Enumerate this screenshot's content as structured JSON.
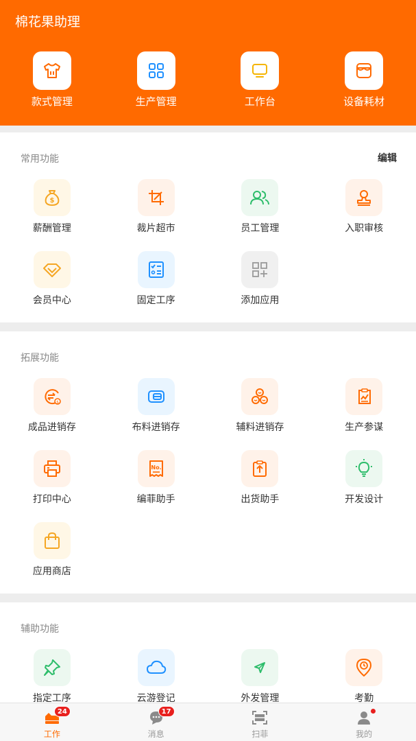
{
  "app": {
    "title": "棉花果助理"
  },
  "quick_actions": [
    {
      "label": "款式管理",
      "icon": "shirt-icon"
    },
    {
      "label": "生产管理",
      "icon": "grid-icon"
    },
    {
      "label": "工作台",
      "icon": "monitor-icon"
    },
    {
      "label": "设备耗材",
      "icon": "store-icon"
    }
  ],
  "sections": {
    "common": {
      "title": "常用功能",
      "edit_label": "编辑",
      "items": [
        {
          "label": "薪酬管理",
          "icon": "money-bag-icon"
        },
        {
          "label": "裁片超市",
          "icon": "crop-icon"
        },
        {
          "label": "员工管理",
          "icon": "users-icon"
        },
        {
          "label": "入职审核",
          "icon": "stamp-icon"
        },
        {
          "label": "会员中心",
          "icon": "diamond-icon"
        },
        {
          "label": "固定工序",
          "icon": "checklist-icon"
        },
        {
          "label": "添加应用",
          "icon": "add-apps-icon"
        }
      ]
    },
    "extended": {
      "title": "拓展功能",
      "items": [
        {
          "label": "成品进销存",
          "icon": "exchange-icon"
        },
        {
          "label": "布料进销存",
          "icon": "fabric-icon"
        },
        {
          "label": "辅料进销存",
          "icon": "buttons-icon"
        },
        {
          "label": "生产参谋",
          "icon": "report-icon"
        },
        {
          "label": "打印中心",
          "icon": "printer-icon"
        },
        {
          "label": "编菲助手",
          "icon": "ticket-icon"
        },
        {
          "label": "出货助手",
          "icon": "shipment-icon"
        },
        {
          "label": "开发设计",
          "icon": "bulb-icon"
        },
        {
          "label": "应用商店",
          "icon": "shopping-bag-icon"
        }
      ]
    },
    "auxiliary": {
      "title": "辅助功能",
      "items": [
        {
          "label": "指定工序",
          "icon": "pin-icon"
        },
        {
          "label": "云游登记",
          "icon": "cloud-icon"
        },
        {
          "label": "外发管理",
          "icon": "send-icon"
        },
        {
          "label": "考勤",
          "icon": "clock-location-icon"
        }
      ]
    }
  },
  "tabbar": [
    {
      "label": "工作",
      "badge": "24",
      "icon": "work-icon",
      "active": true
    },
    {
      "label": "消息",
      "badge": "17",
      "icon": "chat-icon"
    },
    {
      "label": "扫菲",
      "icon": "scan-icon"
    },
    {
      "label": "我的",
      "icon": "user-icon",
      "dot": true
    }
  ],
  "colors": {
    "brand": "#ff6a00",
    "badge": "#e8201e"
  }
}
